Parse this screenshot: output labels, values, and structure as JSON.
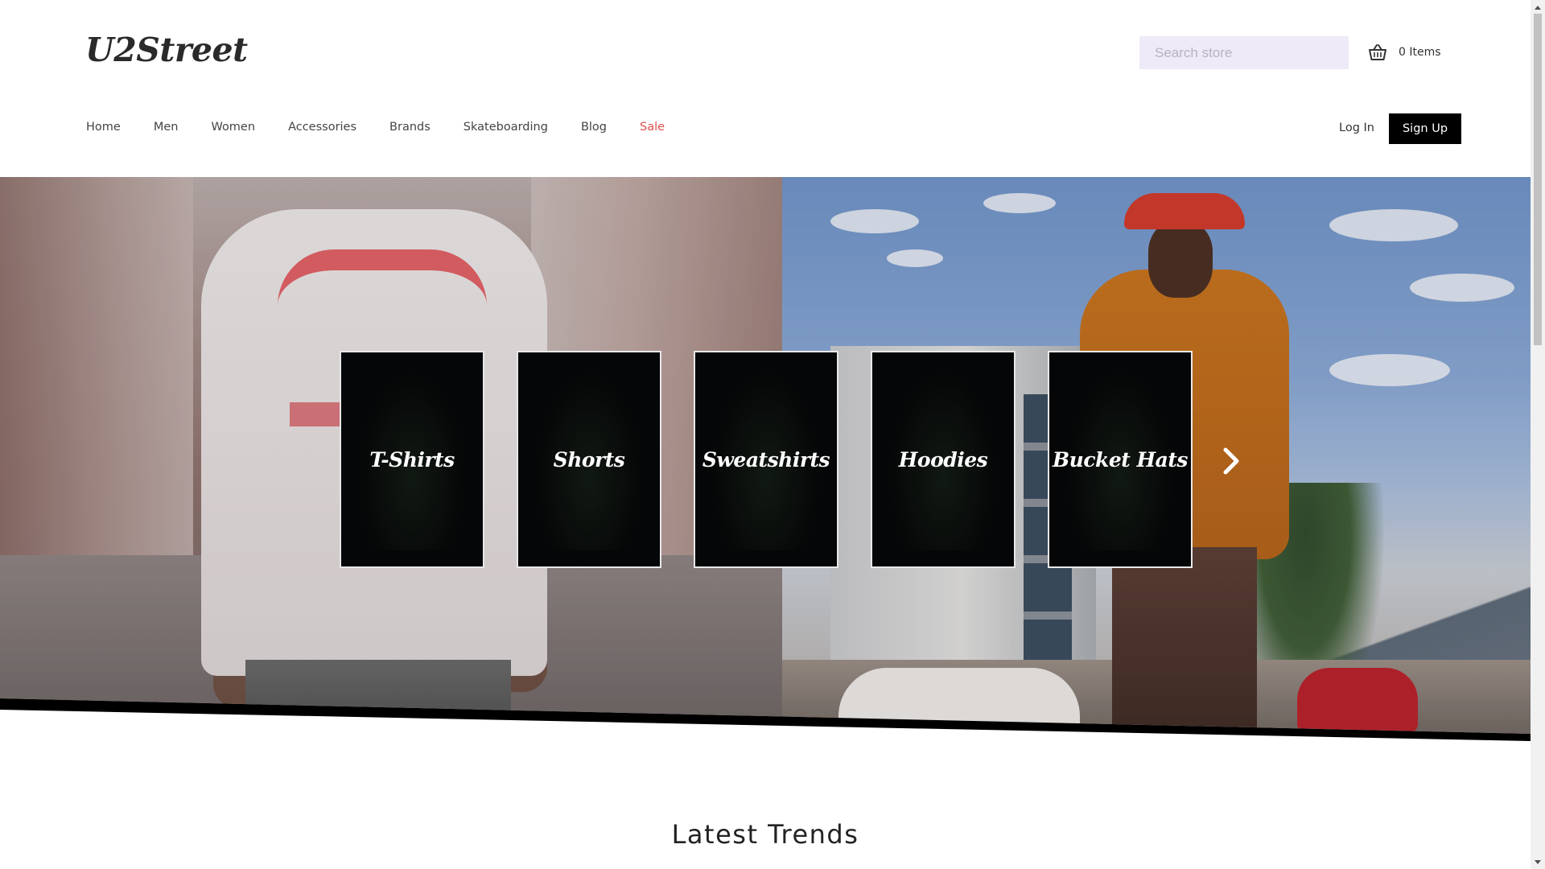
{
  "header": {
    "logo": "U2Street",
    "search_placeholder": "Search store",
    "search_value": "",
    "cart_icon": "shopping-basket-icon",
    "cart_label": "0 Items"
  },
  "nav": {
    "items": [
      {
        "label": "Home"
      },
      {
        "label": "Men"
      },
      {
        "label": "Women"
      },
      {
        "label": "Accessories"
      },
      {
        "label": "Brands"
      },
      {
        "label": "Skateboarding"
      },
      {
        "label": "Blog"
      },
      {
        "label": "Sale",
        "highlight": true
      }
    ],
    "sale_color": "#e2504c",
    "login_label": "Log In",
    "signup_label": "Sign Up"
  },
  "hero": {
    "categories": [
      {
        "label": "T-Shirts"
      },
      {
        "label": "Shorts"
      },
      {
        "label": "Sweatshirts"
      },
      {
        "label": "Hoodies"
      },
      {
        "label": "Bucket Hats"
      }
    ],
    "next_icon": "chevron-right-icon"
  },
  "sections": {
    "latest_trends_title": "Latest Trends"
  },
  "scrollbar": {
    "up_icon": "arrow-up-icon",
    "down_icon": "arrow-down-icon"
  }
}
